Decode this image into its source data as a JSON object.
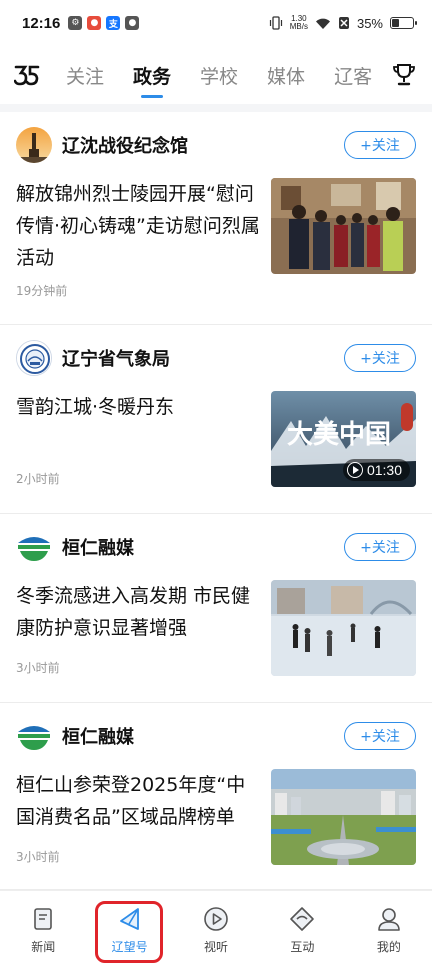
{
  "status_bar": {
    "time": "12:16",
    "speed_value": "1.30",
    "speed_unit": "MB/s",
    "battery": "35%",
    "battery_level": 0.35,
    "icons": [
      "app-icon-1",
      "app-icon-2",
      "alipay-icon",
      "wechat-icon",
      "vibrate-icon",
      "wifi-icon",
      "sim-off-icon",
      "battery-icon"
    ]
  },
  "tabs": {
    "items": [
      {
        "label": "关注",
        "active": false
      },
      {
        "label": "政务",
        "active": true
      },
      {
        "label": "学校",
        "active": false
      },
      {
        "label": "媒体",
        "active": false
      },
      {
        "label": "辽客",
        "active": false
      }
    ]
  },
  "feed": {
    "follow_label": "+关注",
    "cards": [
      {
        "source": "辽沈战役纪念馆",
        "headline": "解放锦州烈士陵园开展“慰问传情·初心铸魂”走访慰问烈属活动",
        "time": "19分钟前",
        "has_video": false
      },
      {
        "source": "辽宁省气象局",
        "headline": "雪韵江城·冬暖丹东",
        "time": "2小时前",
        "has_video": true,
        "video_duration": "01:30",
        "thumb_text": "大美中国"
      },
      {
        "source": "桓仁融媒",
        "headline": "冬季流感进入高发期 市民健康防护意识显著增强",
        "time": "3小时前",
        "has_video": false
      },
      {
        "source": "桓仁融媒",
        "headline": "桓仁山参荣登2025年度“中国消费名品”区域品牌榜单",
        "time": "3小时前",
        "has_video": false
      }
    ]
  },
  "bottom_nav": {
    "items": [
      {
        "label": "新闻",
        "icon": "news-icon",
        "active": false
      },
      {
        "label": "辽望号",
        "icon": "send-icon",
        "active": true
      },
      {
        "label": "视听",
        "icon": "play-icon",
        "active": false
      },
      {
        "label": "互动",
        "icon": "interact-icon",
        "active": false
      },
      {
        "label": "我的",
        "icon": "profile-icon",
        "active": false
      }
    ]
  },
  "colors": {
    "accent": "#2d8ce8",
    "highlight": "#e0242a"
  }
}
